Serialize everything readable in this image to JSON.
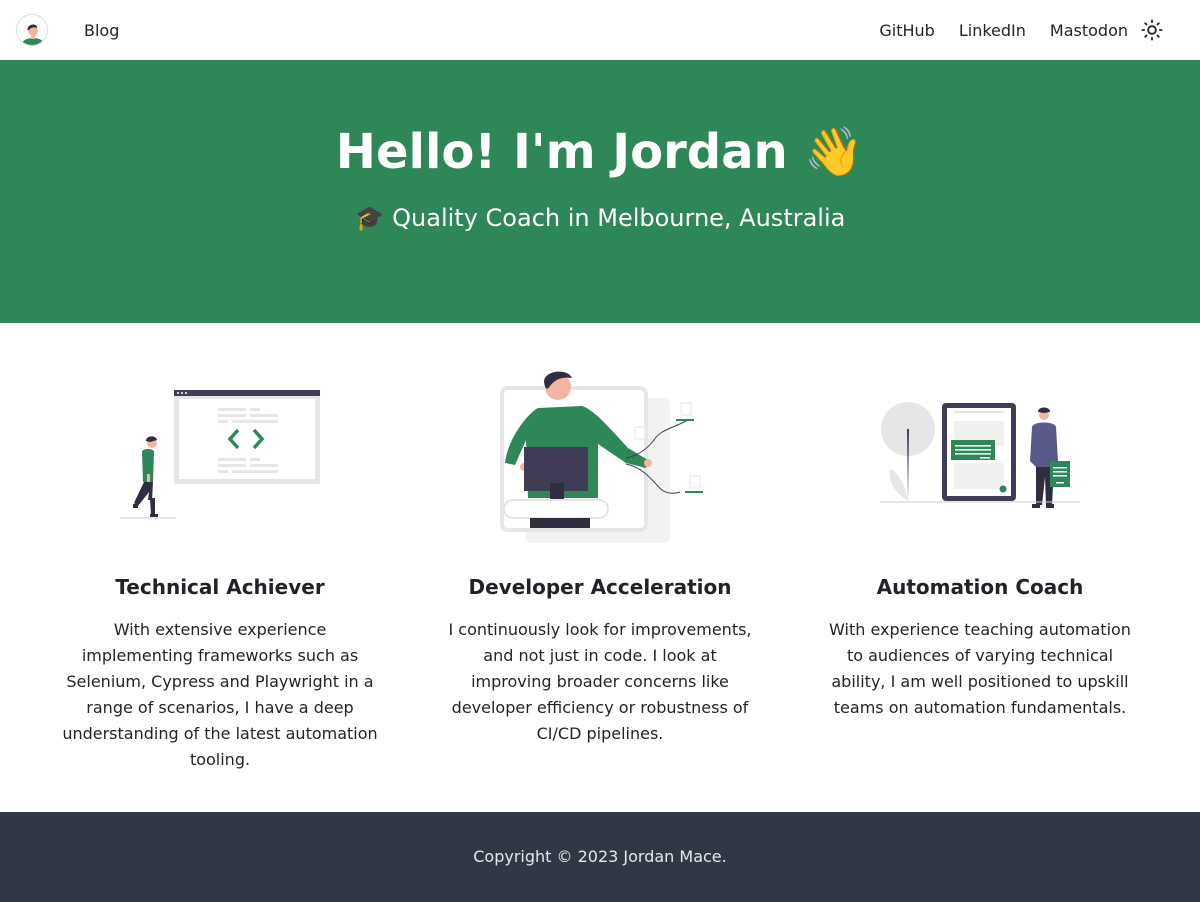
{
  "nav": {
    "blog": "Blog",
    "links": [
      "GitHub",
      "LinkedIn",
      "Mastodon"
    ]
  },
  "hero": {
    "title": "Hello! I'm Jordan 👋",
    "subtitle": "🎓 Quality Coach in Melbourne, Australia"
  },
  "features": [
    {
      "title": "Technical Achiever",
      "text": "With extensive experience implementing frameworks such as Selenium, Cypress and Playwright in a range of scenarios, I have a deep understanding of the latest automation tooling."
    },
    {
      "title": "Developer Acceleration",
      "text": "I continuously look for improvements, and not just in code. I look at improving broader concerns like developer efficiency or robustness of CI/CD pipelines."
    },
    {
      "title": "Automation Coach",
      "text": "With experience teaching automation to audiences of varying technical ability, I am well positioned to upskill teams on automation fundamentals."
    }
  ],
  "footer": {
    "copyright": "Copyright © 2023 Jordan Mace."
  },
  "colors": {
    "hero_bg": "#2e8757",
    "footer_bg": "#303846",
    "accent": "#2e8757",
    "dark": "#3f3d56"
  },
  "icons": [
    "avatar",
    "sun-icon"
  ]
}
